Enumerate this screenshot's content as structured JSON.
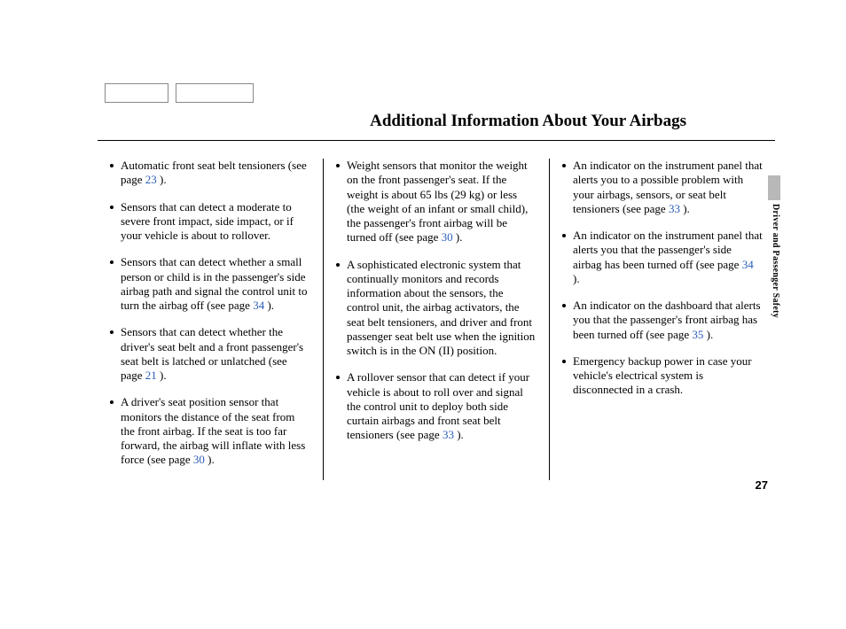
{
  "heading": "Additional Information About Your Airbags",
  "side_label": "Driver and Passenger Safety",
  "page_number": "27",
  "columns": [
    [
      {
        "text_pre": "Automatic front seat belt tensioners (see page ",
        "ref": "23 ",
        "text_post": ")."
      },
      {
        "text_pre": "Sensors that can detect a moderate to severe front impact, side impact, or if your vehicle is about to rollover.",
        "ref": "",
        "text_post": ""
      },
      {
        "text_pre": "Sensors that can detect whether a small person or child is in the passenger's side airbag path and signal the control unit to turn the airbag off (see page  ",
        "ref": "34  ",
        "text_post": ")."
      },
      {
        "text_pre": "Sensors that can detect whether the driver's seat belt and a front passenger's seat belt is latched or unlatched (see page ",
        "ref": "21 ",
        "text_post": ")."
      },
      {
        "text_pre": "A driver's seat position sensor that monitors the distance of the seat from the front airbag. If the seat is too far forward, the airbag will inflate with less force (see page ",
        "ref": "30 ",
        "text_post": ")."
      }
    ],
    [
      {
        "text_pre": "Weight sensors that monitor the weight on the front passenger's seat. If the weight is about 65 lbs (29 kg) or less (the weight of an infant or small child), the passenger's front airbag will be turned off (see page ",
        "ref": "30 ",
        "text_post": ")."
      },
      {
        "text_pre": "A sophisticated electronic system that continually monitors and records information about the sensors, the control unit, the airbag activators, the seat belt tensioners, and driver and front passenger seat belt use when the ignition switch is in the ON (II) position.",
        "ref": "",
        "text_post": ""
      },
      {
        "text_pre": "A rollover sensor that can detect if your vehicle is about to roll over and signal the control unit to deploy both side curtain airbags and front seat belt tensioners (see page  ",
        "ref": "33  ",
        "text_post": ")."
      }
    ],
    [
      {
        "text_pre": "An indicator on the instrument panel that alerts you to a possible problem with your airbags, sensors, or seat belt tensioners (see page ",
        "ref": "33 ",
        "text_post": ")."
      },
      {
        "text_pre": "An indicator on the instrument panel that alerts you that the passenger's side airbag has been turned off (see page ",
        "ref": "34 ",
        "text_post": ")."
      },
      {
        "text_pre": "An indicator on the dashboard that alerts you that the passenger's front airbag has been turned off (see page ",
        "ref": "35 ",
        "text_post": ")."
      },
      {
        "text_pre": "Emergency backup power in case your vehicle's electrical system is disconnected in a crash.",
        "ref": "",
        "text_post": ""
      }
    ]
  ]
}
